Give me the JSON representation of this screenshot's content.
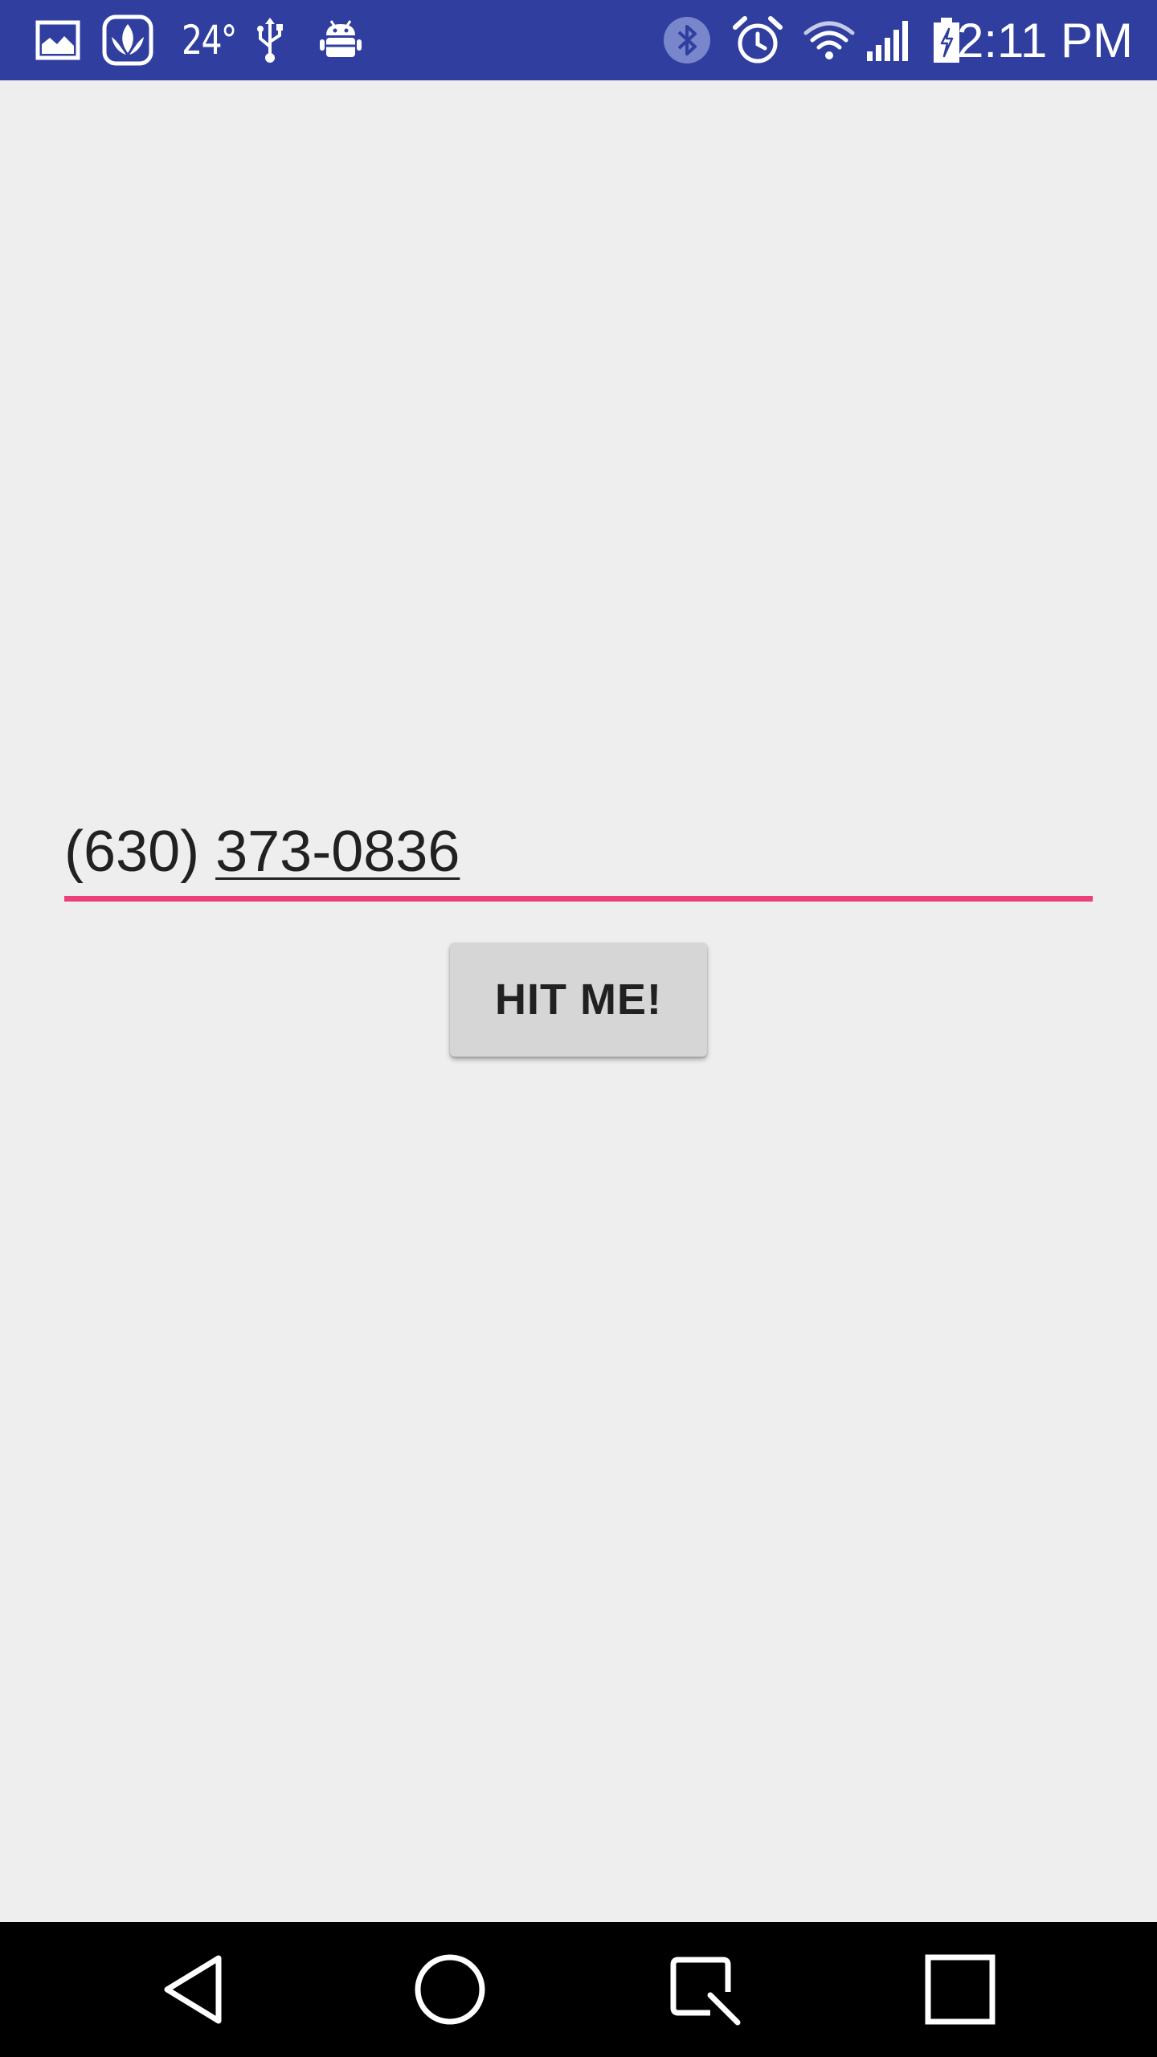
{
  "status_bar": {
    "temperature": "24°",
    "time": "2:11 PM",
    "background": "#303f9f",
    "left_icons": [
      "gallery-icon",
      "saavn-icon",
      "usb-icon",
      "android-debug-icon"
    ],
    "right_icons": [
      "bluetooth-icon",
      "alarm-icon",
      "wifi-icon",
      "signal-icon",
      "battery-charging-icon"
    ]
  },
  "main": {
    "phone_input": {
      "area_code": "(630) ",
      "number": "373-0836",
      "underline_color": "#ec407a"
    },
    "hit_button": {
      "label": "HIT ME!"
    }
  },
  "nav_bar": {
    "buttons": [
      "back-icon",
      "home-icon",
      "quick-memo-icon",
      "recents-icon"
    ]
  }
}
